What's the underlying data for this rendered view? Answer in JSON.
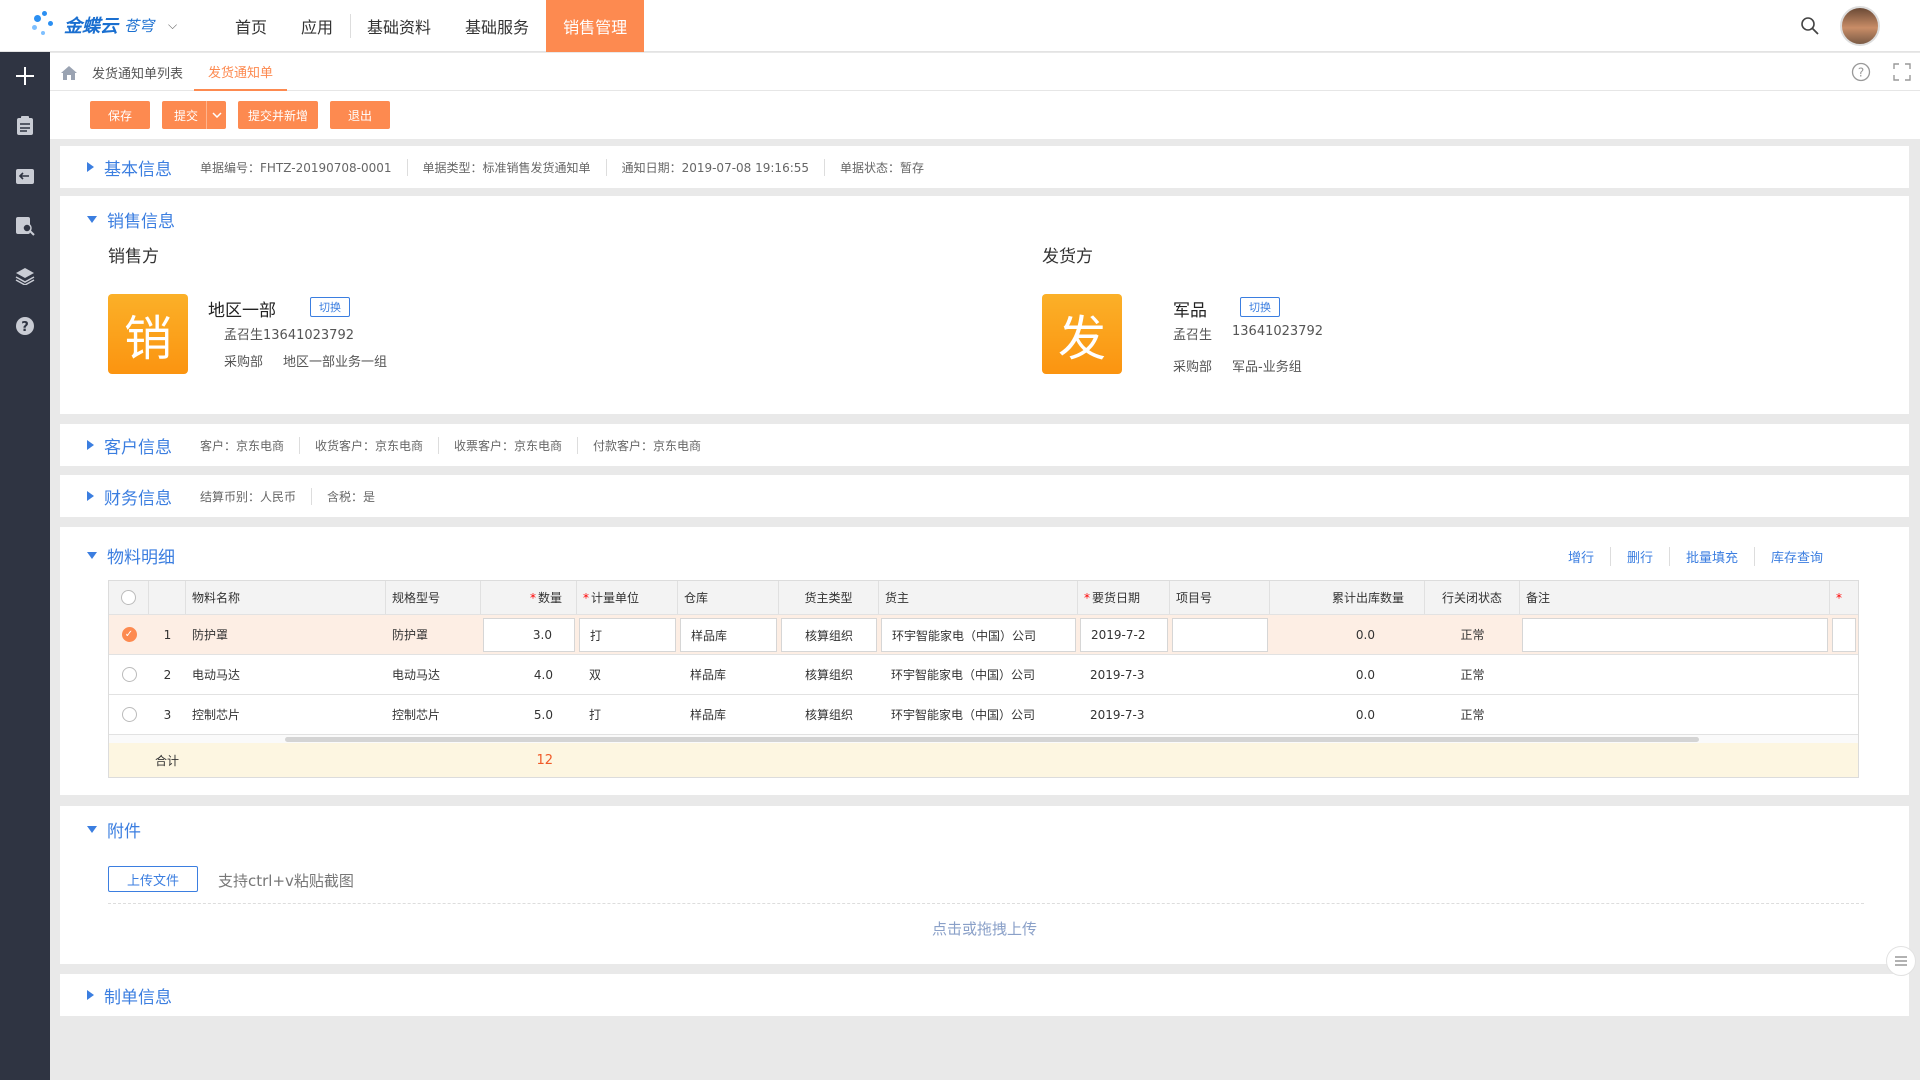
{
  "brand": {
    "name": "金蝶云",
    "sub": "苍穹"
  },
  "topnav": [
    "首页",
    "应用",
    "基础资料",
    "基础服务",
    "销售管理"
  ],
  "tabs": {
    "list": "发货通知单列表",
    "current": "发货通知单"
  },
  "toolbar": {
    "save": "保存",
    "submit": "提交",
    "submit_new": "提交并新增",
    "exit": "退出"
  },
  "basic": {
    "title": "基本信息",
    "meta": [
      "单据编号：FHTZ-20190708-0001",
      "单据类型：标准销售发货通知单",
      "通知日期：2019-07-08 19:16:55",
      "单据状态：暂存"
    ]
  },
  "sales": {
    "title": "销售信息",
    "seller": {
      "label": "销售方",
      "icon_char": "销",
      "name": "地区一部",
      "switch": "切换",
      "contact": "孟召生13641023792",
      "dept_label": "采购部",
      "dept": "地区一部业务一组"
    },
    "shipper": {
      "label": "发货方",
      "icon_char": "发",
      "name": "军品",
      "switch": "切换",
      "contact_name": "孟召生",
      "contact_phone": "13641023792",
      "dept_label": "采购部",
      "dept": "军品-业务组"
    }
  },
  "customer": {
    "title": "客户信息",
    "meta": [
      "客户：京东电商",
      "收货客户：京东电商",
      "收票客户：京东电商",
      "付款客户：京东电商"
    ]
  },
  "finance": {
    "title": "财务信息",
    "meta": [
      "结算币别：人民币",
      "含税：是"
    ]
  },
  "materials": {
    "title": "物料明细",
    "actions": [
      "增行",
      "删行",
      "批量填充",
      "库存查询"
    ],
    "columns": [
      "物料名称",
      "规格型号",
      "数量",
      "计量单位",
      "仓库",
      "货主类型",
      "货主",
      "要货日期",
      "项目号",
      "累计出库数量",
      "行关闭状态",
      "备注"
    ],
    "rows": [
      {
        "no": "1",
        "name": "防护罩",
        "spec": "防护罩",
        "qty": "3.0",
        "unit": "打",
        "wh": "样品库",
        "owner_type": "核算组织",
        "owner": "环宇智能家电（中国）公司",
        "date": "2019-7-2",
        "project": "",
        "out_qty": "0.0",
        "status": "正常"
      },
      {
        "no": "2",
        "name": "电动马达",
        "spec": "电动马达",
        "qty": "4.0",
        "unit": "双",
        "wh": "样品库",
        "owner_type": "核算组织",
        "owner": "环宇智能家电（中国）公司",
        "date": "2019-7-3",
        "project": "",
        "out_qty": "0.0",
        "status": "正常"
      },
      {
        "no": "3",
        "name": "控制芯片",
        "spec": "控制芯片",
        "qty": "5.0",
        "unit": "打",
        "wh": "样品库",
        "owner_type": "核算组织",
        "owner": "环宇智能家电（中国）公司",
        "date": "2019-7-3",
        "project": "",
        "out_qty": "0.0",
        "status": "正常"
      }
    ],
    "total_label": "合计",
    "total_qty": "12"
  },
  "attachment": {
    "title": "附件",
    "upload": "上传文件",
    "paste_tip": "支持ctrl+v粘贴截图",
    "drop_tip": "点击或拖拽上传"
  },
  "maker": {
    "title": "制单信息"
  },
  "colors": {
    "accent": "#fd8a50",
    "link": "#3b7ee0",
    "sidebar": "#2f3442"
  }
}
